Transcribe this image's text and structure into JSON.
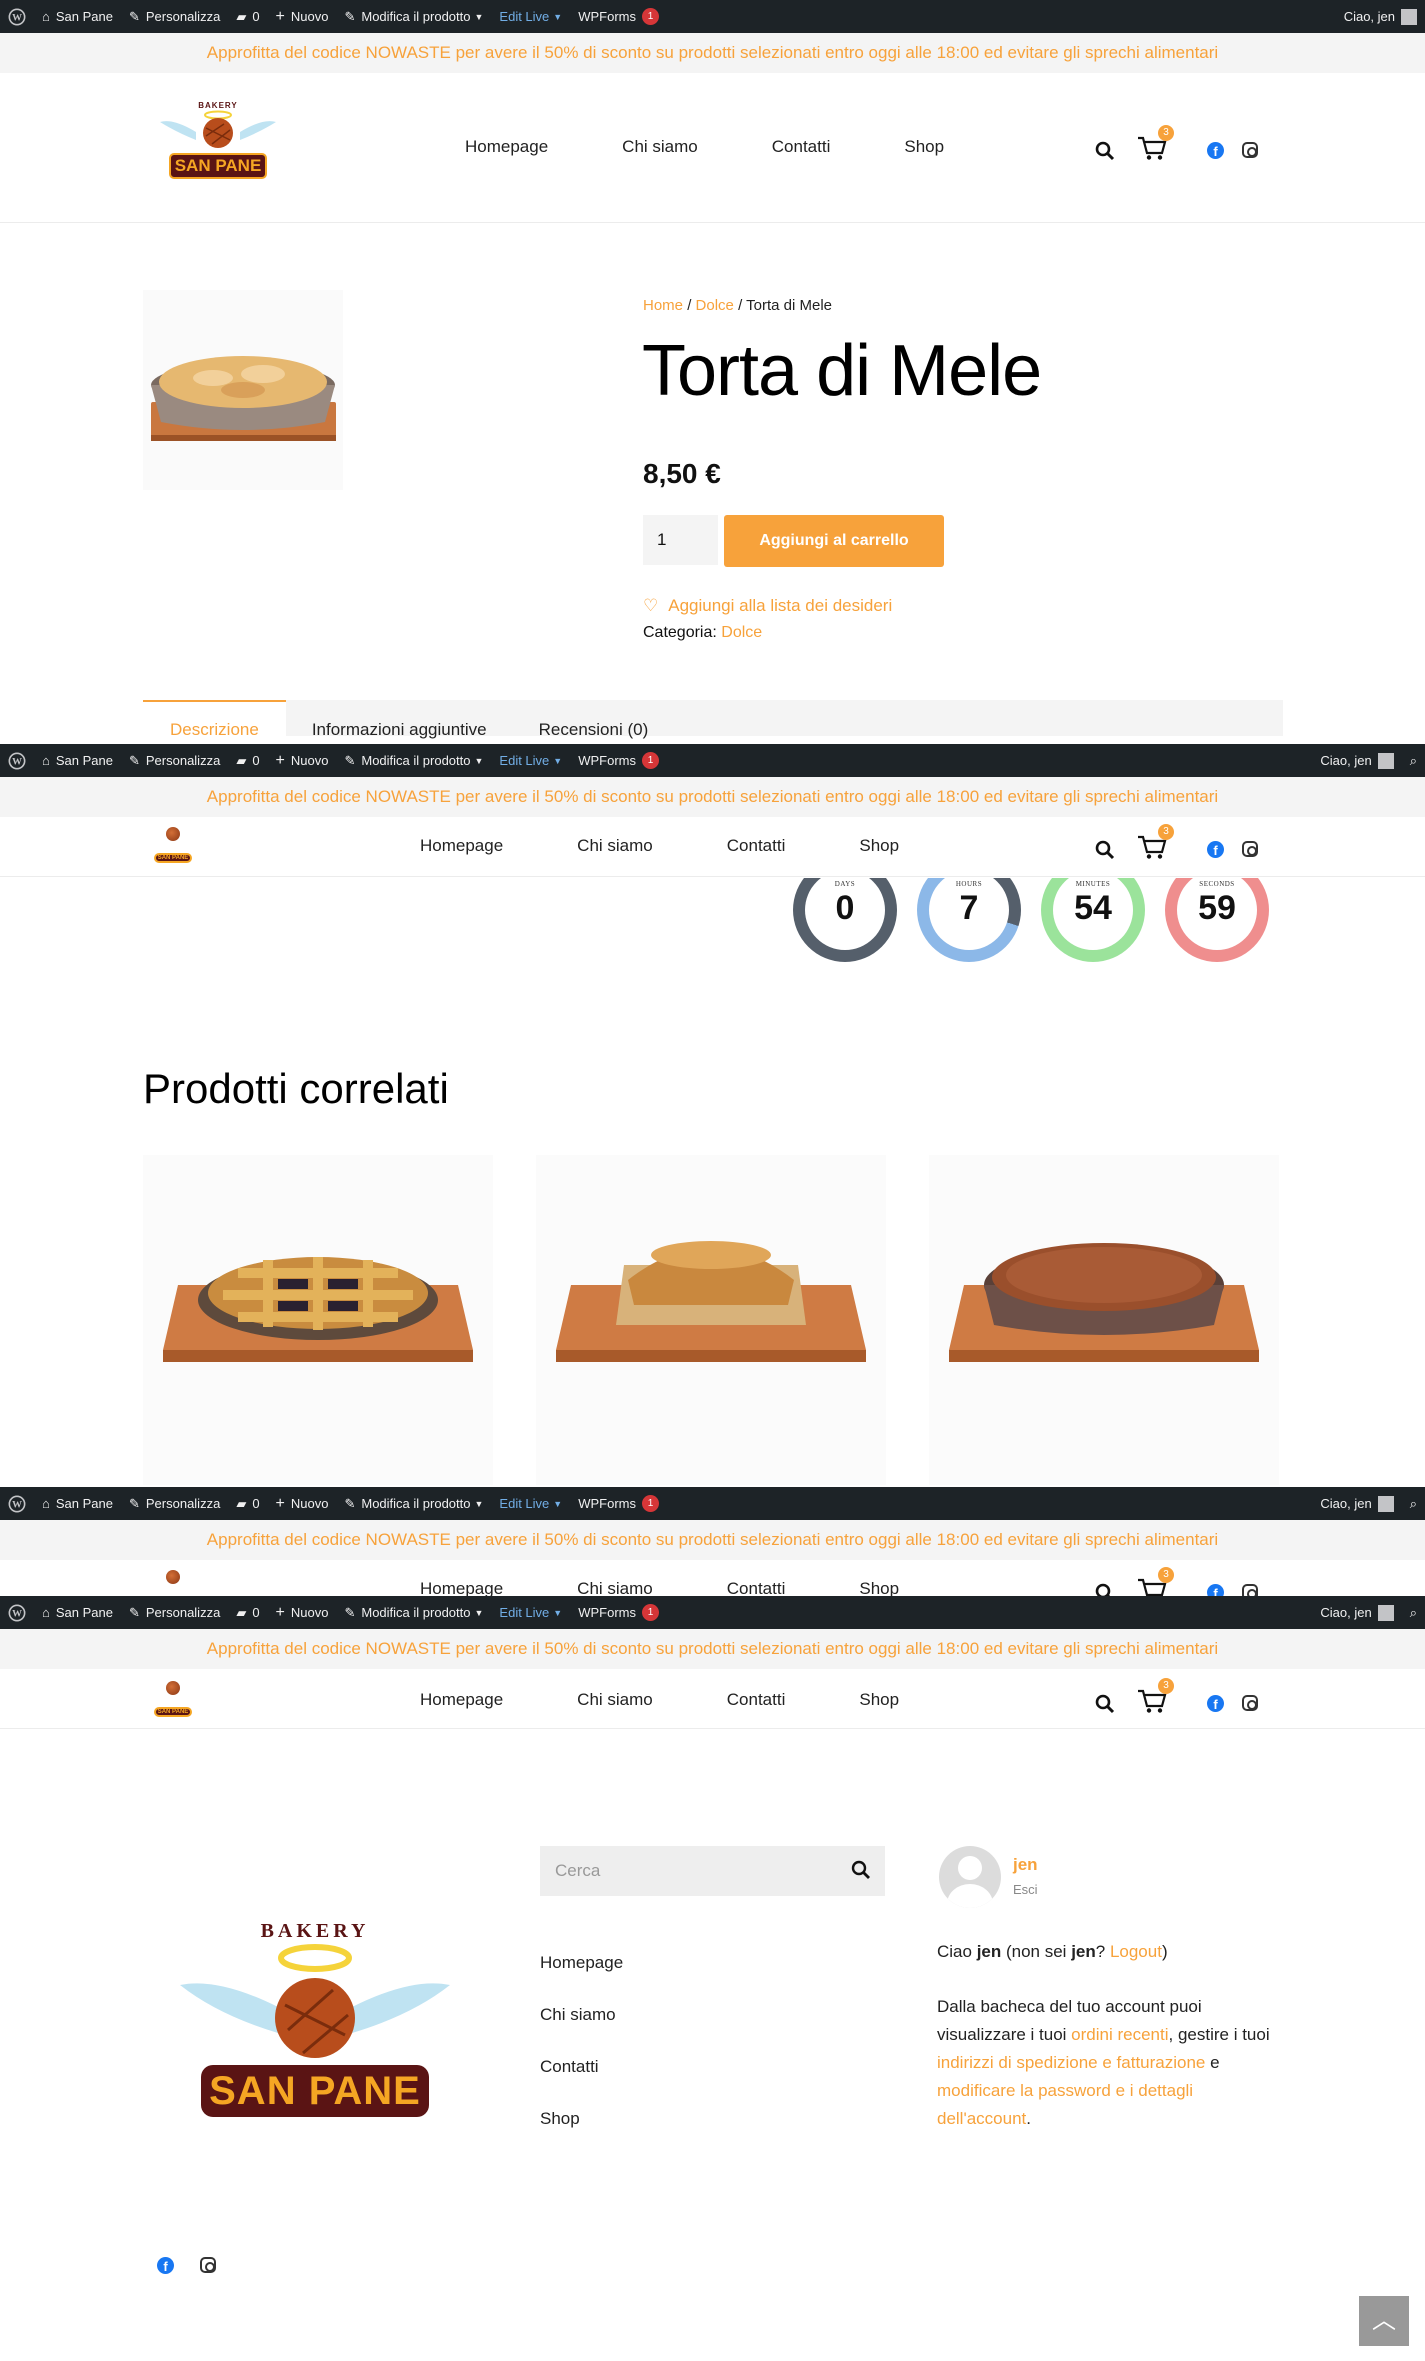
{
  "wpbar": {
    "site": "San Pane",
    "customize": "Personalizza",
    "comments": "0",
    "new": "Nuovo",
    "edit": "Modifica il prodotto",
    "live": "Edit Live",
    "forms": "WPForms",
    "forms_count": "1",
    "greeting": "Ciao, jen"
  },
  "promo": "Approfitta del codice NOWASTE per avere il 50% di sconto su prodotti selezionati entro oggi alle 18:00 ed evitare gli sprechi alimentari",
  "logo": {
    "top": "BAKERY",
    "name": "SAN PANE"
  },
  "nav": [
    "Homepage",
    "Chi siamo",
    "Contatti",
    "Shop"
  ],
  "cart_count": "3",
  "breadcrumb": {
    "home": "Home",
    "sep": "/",
    "cat": "Dolce",
    "current": "Torta di Mele"
  },
  "product": {
    "title": "Torta di Mele",
    "price": "8,50 €",
    "qty": "1",
    "add": "Aggiungi al carrello",
    "wishlist": "Aggiungi alla lista dei desideri",
    "cat_label": "Categoria:",
    "cat": "Dolce"
  },
  "tabs": [
    "Descrizione",
    "Informazioni aggiuntive",
    "Recensioni (0)"
  ],
  "timer": [
    {
      "label": "DAYS",
      "value": "0",
      "color": "#555f6b",
      "fill": 1.0
    },
    {
      "label": "HOURS",
      "value": "7",
      "color": "#555f6b",
      "track": "#8cb8e8",
      "fill": 0.3
    },
    {
      "label": "MINUTES",
      "value": "54",
      "color": "#9be39b",
      "fill": 0.9
    },
    {
      "label": "SECONDS",
      "value": "59",
      "color": "#ef8e8e",
      "fill": 0.98
    }
  ],
  "related_title": "Prodotti correlati",
  "footer": {
    "search_placeholder": "Cerca",
    "links": [
      "Homepage",
      "Chi siamo",
      "Contatti",
      "Shop"
    ],
    "user": "jen",
    "logout": "Esci",
    "acc_p1_a": "Ciao ",
    "acc_user": "jen",
    "acc_p1_b": " (non sei ",
    "acc_p1_c": "? ",
    "acc_logout": "Logout",
    "acc_p1_d": ")",
    "acc_p2_a": "Dalla bacheca del tuo account puoi visualizzare i tuoi ",
    "acc_orders": "ordini recenti",
    "acc_p2_b": ", gestire i tuoi ",
    "acc_addr": "indirizzi di spedizione e fatturazione",
    "acc_p2_c": " e ",
    "acc_pw": "modificare la password e i dettagli dell'account",
    "acc_p2_d": "."
  },
  "colors": {
    "accent": "#f7a23b",
    "wpbar": "#1d2327",
    "badge": "#d63638"
  }
}
